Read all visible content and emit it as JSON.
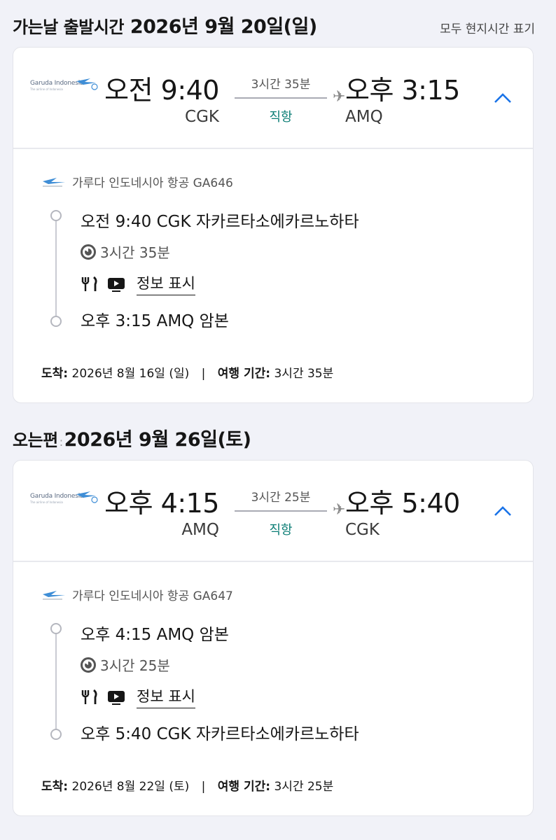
{
  "outbound": {
    "heading_lead": "가는날 출발시간",
    "heading_date": "2026년 9월 20일(일)",
    "tz_note": "모두 현지시간 표기",
    "summary": {
      "airline_logo_text": "Garuda Indonesia",
      "airline_logo_tagline": "The airline of Indonesia",
      "dep_time": "오전 9:40",
      "dep_airport": "CGK",
      "duration": "3시간 35분",
      "direct": "직항",
      "plane_icon": "✈",
      "arr_time": "오후 3:15",
      "arr_airport": "AMQ"
    },
    "detail": {
      "airline_flight": "가루다 인도네시아 항공 GA646",
      "dep_line": "오전 9:40 CGK 자카르타소에카르노하타",
      "duration": "3시간 35분",
      "info_link": "정보 표시",
      "arr_line": "오후 3:15 AMQ 암본",
      "arrival_label": "도착:",
      "arrival_value": "2026년 8월 16일 (일)",
      "divider": "|",
      "travel_label": "여행 기간:",
      "travel_value": "3시간 35분"
    }
  },
  "return": {
    "heading_lead": "오는편",
    "heading_sep": ":",
    "heading_date": "2026년 9월 26일(토)",
    "summary": {
      "airline_logo_text": "Garuda Indonesia",
      "airline_logo_tagline": "The airline of Indonesia",
      "dep_time": "오후 4:15",
      "dep_airport": "AMQ",
      "duration": "3시간 25분",
      "direct": "직항",
      "plane_icon": "✈",
      "arr_time": "오후 5:40",
      "arr_airport": "CGK"
    },
    "detail": {
      "airline_flight": "가루다 인도네시아 항공 GA647",
      "dep_line": "오후 4:15 AMQ 암본",
      "duration": "3시간 25분",
      "info_link": "정보 표시",
      "arr_line": "오후 5:40 CGK 자카르타소에카르노하타",
      "arrival_label": "도착:",
      "arrival_value": "2026년 8월 22일 (토)",
      "divider": "|",
      "travel_label": "여행 기간:",
      "travel_value": "3시간 25분"
    }
  },
  "colors": {
    "accent_chevron": "#1a73e8",
    "direct_green": "#0b7d75",
    "logo_blue": "#3f8ed6"
  },
  "icons": [
    "garuda-logo-icon",
    "airplane-icon",
    "chevron-up-icon",
    "clock-icon",
    "meal-icon",
    "entertainment-icon"
  ]
}
